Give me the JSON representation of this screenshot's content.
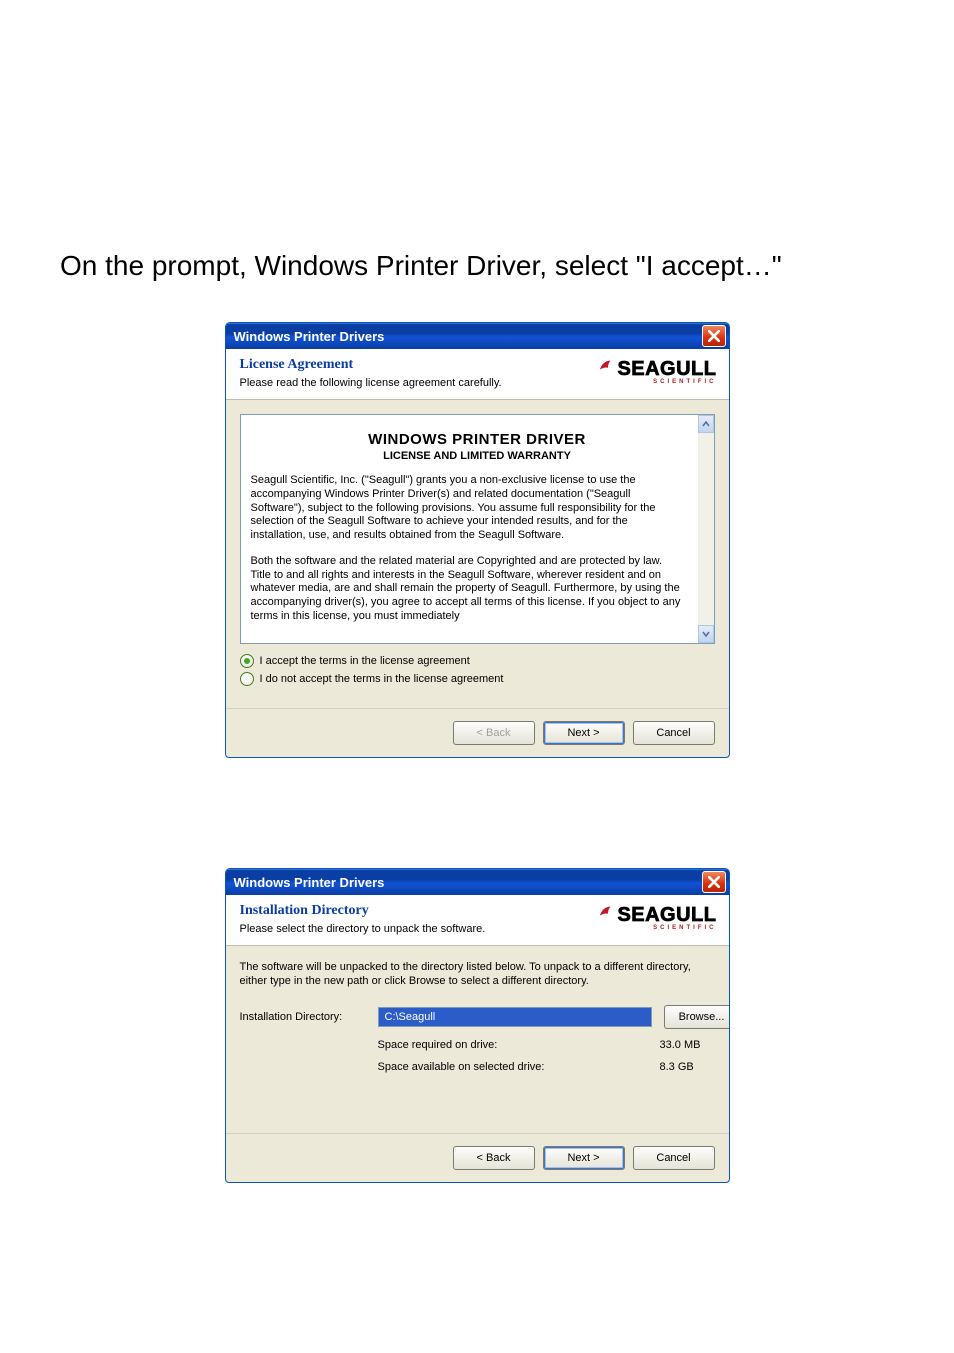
{
  "instruction_text": "On the prompt, Windows Printer Driver, select \"I accept…\"",
  "dialog1": {
    "title": "Windows Printer Drivers",
    "header_title": "License Agreement",
    "header_sub": "Please read the following license agreement carefully.",
    "logo_name": "SEAGULL",
    "logo_sub": "SCIENTIFIC",
    "license_heading": "WINDOWS PRINTER DRIVER",
    "license_subheading": "LICENSE AND LIMITED WARRANTY",
    "license_para1": "Seagull Scientific, Inc. (\"Seagull\") grants you a non-exclusive license to use the accompanying Windows Printer Driver(s) and related documentation (\"Seagull Software\"), subject to the following provisions.  You assume full responsibility for the selection of the Seagull Software to achieve your intended results, and for the installation, use, and results obtained from the Seagull Software.",
    "license_para2": "Both the software and the related material are Copyrighted and are protected by law.  Title to and all rights and interests in the Seagull Software, wherever resident and on whatever media, are and shall remain the property of Seagull.  Furthermore, by using the accompanying driver(s), you agree to accept all terms of this license.  If you object to any terms in this license, you must immediately",
    "radio_accept": "I accept the terms in the license agreement",
    "radio_reject": "I do not accept the terms in the license agreement",
    "btn_back": "< Back",
    "btn_next": "Next >",
    "btn_cancel": "Cancel"
  },
  "dialog2": {
    "title": "Windows Printer Drivers",
    "header_title": "Installation Directory",
    "header_sub": "Please select the directory to unpack the software.",
    "logo_name": "SEAGULL",
    "logo_sub": "SCIENTIFIC",
    "desc": "The software will be unpacked to the directory listed below.  To unpack to a different directory, either type in the new path or click Browse to select a different directory.",
    "dir_label": "Installation Directory:",
    "dir_value": "C:\\Seagull",
    "browse_label": "Browse...",
    "space_req_label": "Space required on drive:",
    "space_req_val": "33.0 MB",
    "space_avail_label": "Space available on selected drive:",
    "space_avail_val": "8.3 GB",
    "btn_back": "< Back",
    "btn_next": "Next >",
    "btn_cancel": "Cancel"
  }
}
